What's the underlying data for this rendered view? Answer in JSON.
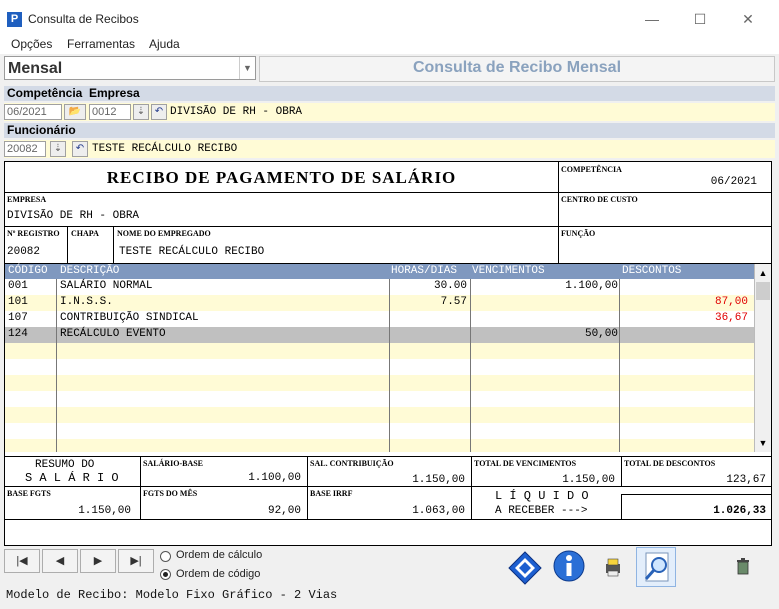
{
  "window": {
    "title": "Consulta de Recibos",
    "app_icon": "P",
    "minimize": "—",
    "maximize": "☐",
    "close": "✕"
  },
  "menu": [
    "Opções",
    "Ferramentas",
    "Ajuda"
  ],
  "toolbar": {
    "view_select": "Mensal",
    "page_title": "Consulta de Recibo Mensal"
  },
  "header": {
    "competencia_label": "Competência",
    "empresa_label": "Empresa",
    "competencia_value": "06/2021",
    "empresa_code": "0012",
    "empresa_name": "DIVISÃO DE RH - OBRA",
    "funcionario_label": "Funcionário",
    "funcionario_code": "20082",
    "funcionario_name": "TESTE RECÁLCULO RECIBO"
  },
  "receipt": {
    "title": "RECIBO DE PAGAMENTO DE SALÁRIO",
    "competencia_label": "COMPETÊNCIA",
    "competencia": "06/2021",
    "empresa_label": "EMPRESA",
    "empresa": "DIVISÃO DE RH - OBRA",
    "centro_custo_label": "CENTRO DE CUSTO",
    "registro_label": "Nº REGISTRO",
    "chapa_label": "CHAPA",
    "nome_label": "NOME DO EMPREGADO",
    "funcao_label": "FUNÇÃO",
    "registro": "20082",
    "nome": "TESTE RECÁLCULO RECIBO",
    "columns": [
      "CÓDIGO",
      "DESCRIÇÃO",
      "HORAS/DIAS",
      "VENCIMENTOS",
      "DESCONTOS"
    ],
    "rows": [
      {
        "codigo": "001",
        "descricao": "SALÁRIO NORMAL",
        "horas": "30.00",
        "vencimentos": "1.100,00",
        "descontos": ""
      },
      {
        "codigo": "101",
        "descricao": "I.N.S.S.",
        "horas": "7.57",
        "vencimentos": "",
        "descontos": "87,00"
      },
      {
        "codigo": "107",
        "descricao": "CONTRIBUIÇÃO SINDICAL",
        "horas": "",
        "vencimentos": "",
        "descontos": "36,67"
      },
      {
        "codigo": "124",
        "descricao": "RECÁLCULO EVENTO",
        "horas": "",
        "vencimentos": "50,00",
        "descontos": ""
      }
    ],
    "resumo_line1": "RESUMO DO",
    "resumo_line2": "S A L Á R I O",
    "salario_base_label": "SALÁRIO-BASE",
    "salario_base": "1.100,00",
    "sal_contribuicao_label": "SAL. CONTRIBUIÇÃO",
    "sal_contribuicao": "1.150,00",
    "total_vencimentos_label": "TOTAL DE VENCIMENTOS",
    "total_vencimentos": "1.150,00",
    "total_descontos_label": "TOTAL DE DESCONTOS",
    "total_descontos": "123,67",
    "base_fgts_label": "BASE FGTS",
    "base_fgts": "1.150,00",
    "fgts_mes_label": "FGTS DO MÊS",
    "fgts_mes": "92,00",
    "base_irrf_label": "BASE IRRF",
    "base_irrf": "1.063,00",
    "liquido_line1": "L Í Q U I D O",
    "liquido_line2": "A RECEBER --->",
    "liquido": "1.026,33"
  },
  "controls": {
    "nav_first": "|◀",
    "nav_prev": "◀",
    "nav_next": "▶",
    "nav_last": "▶|",
    "radio_calc": "Ordem de cálculo",
    "radio_code": "Ordem de código"
  },
  "status": "Modelo de Recibo: Modelo Fixo Gráfico - 2 Vias",
  "colors": {
    "grid_header": "#7f98bf",
    "row_alt": "#fffbd6",
    "row_selected": "#c0c0c0",
    "discount": "#e00000",
    "title_blue": "#8aa2be"
  }
}
